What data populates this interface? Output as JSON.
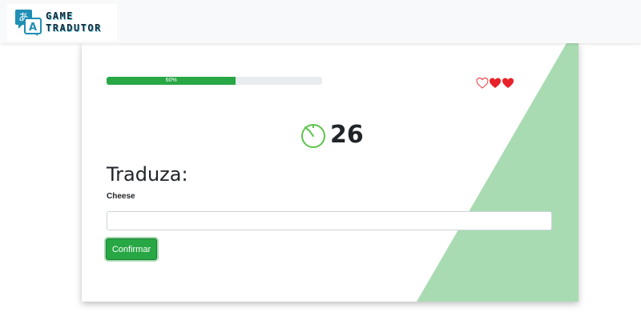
{
  "header": {
    "brand_line1": "GAME",
    "brand_line2": "TRADUTOR",
    "brand_icon": "translate-icon"
  },
  "game": {
    "progress_percent": 60,
    "progress_label": "60%",
    "lives_total": 3,
    "lives_remaining": 2,
    "timer_value": "26",
    "title": "Traduza:",
    "word": "Cheese",
    "answer_value": "",
    "answer_placeholder": "",
    "confirm_label": "Confirmar"
  },
  "colors": {
    "accent": "#28a745",
    "accent_light": "#a9dbb2",
    "heart": "#e8222a",
    "timer": "#5cc44d"
  }
}
